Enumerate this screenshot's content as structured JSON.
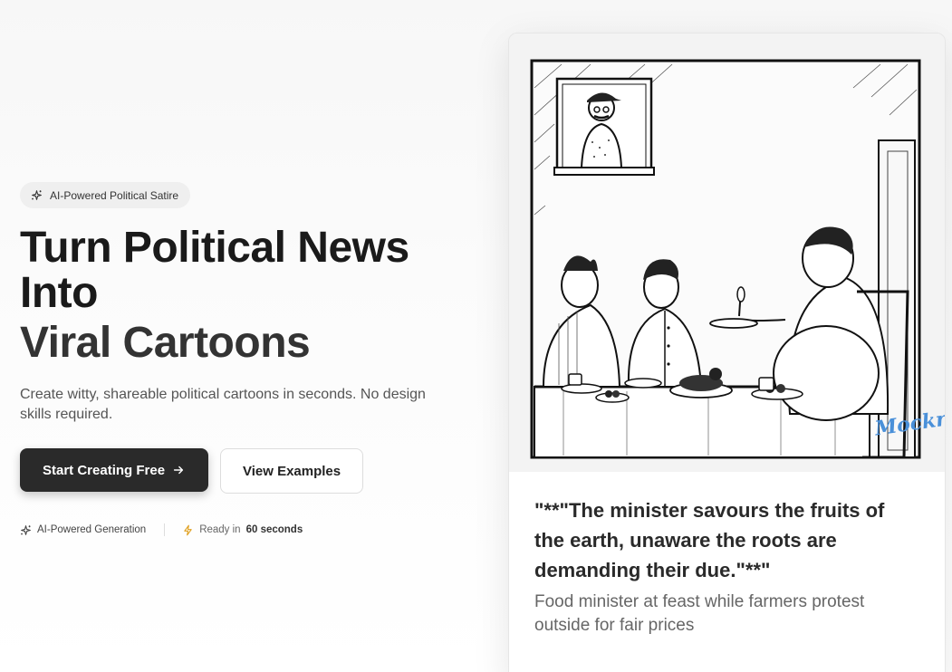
{
  "hero": {
    "badge_label": "AI-Powered Political Satire",
    "headline_line1": "Turn Political News Into",
    "headline_line2": "Viral Cartoons",
    "subtitle": "Create witty, shareable political cartoons in seconds. No design skills required.",
    "primary_cta": "Start Creating Free",
    "secondary_cta": "View Examples",
    "features": [
      {
        "label": "AI-Powered Generation",
        "icon": "sparkles-icon"
      },
      {
        "prefix": "Ready in",
        "highlight": "60 seconds",
        "icon": "lightning-icon"
      }
    ]
  },
  "card": {
    "watermark": "Mockr",
    "quote": "\"**\"The minister savours the fruits of the earth, unaware the roots are demanding their due.\"**\"",
    "context": "Food minister at feast while farmers protest outside for fair prices"
  },
  "colors": {
    "primary_button": "#2a2a2a",
    "accent_lightning": "#e0a020",
    "watermark_blue": "#4a90d9"
  }
}
